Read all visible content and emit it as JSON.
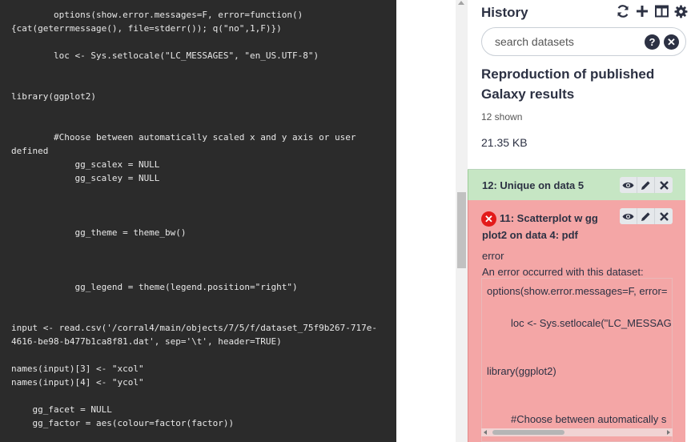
{
  "code": {
    "lines": [
      "        options(show.error.messages=F, error=function()",
      "{cat(geterrmessage(), file=stderr()); q(\"no\",1,F)})",
      "        loc <- Sys.setlocale(\"LC_MESSAGES\", \"en_US.UTF-8\")",
      "library(ggplot2)",
      "        #Choose between automatically scaled x and y axis or user",
      "defined",
      "            gg_scalex = NULL",
      "            gg_scaley = NULL",
      "            gg_theme = theme_bw()",
      "            gg_legend = theme(legend.position=\"right\")",
      "input <- read.csv('/corral4/main/objects/7/5/f/dataset_75f9b267-717e-",
      "4616-be98-b477b1ca8f81.dat', sep='\\t', header=TRUE)",
      "names(input)[3] <- \"xcol\"",
      "names(input)[4] <- \"ycol\"",
      "    gg_facet = NULL",
      "    gg_factor = aes(colour=factor(factor))"
    ]
  },
  "history": {
    "title": "History",
    "icons": [
      "sync-icon",
      "plus-icon",
      "columns-icon",
      "gear-icon"
    ],
    "search_placeholder": "search datasets",
    "name": "Reproduction of published Galaxy results",
    "shown": "12 shown",
    "size": "21.35 KB"
  },
  "datasets": {
    "ok": {
      "title": "12: Unique on data 5",
      "color": "#c6e6c4"
    },
    "error": {
      "title": "11: Scatterplot w gg plot2 on data 4: pdf",
      "state": "error",
      "message": "An error occurred with this dataset:",
      "color": "#f4a6a6",
      "code_lines": [
        "options(show.error.messages=F, error=",
        "loc <- Sys.setlocale(\"LC_MESSAGE",
        "library(ggplot2)",
        "#Choose between automatically s"
      ]
    }
  }
}
